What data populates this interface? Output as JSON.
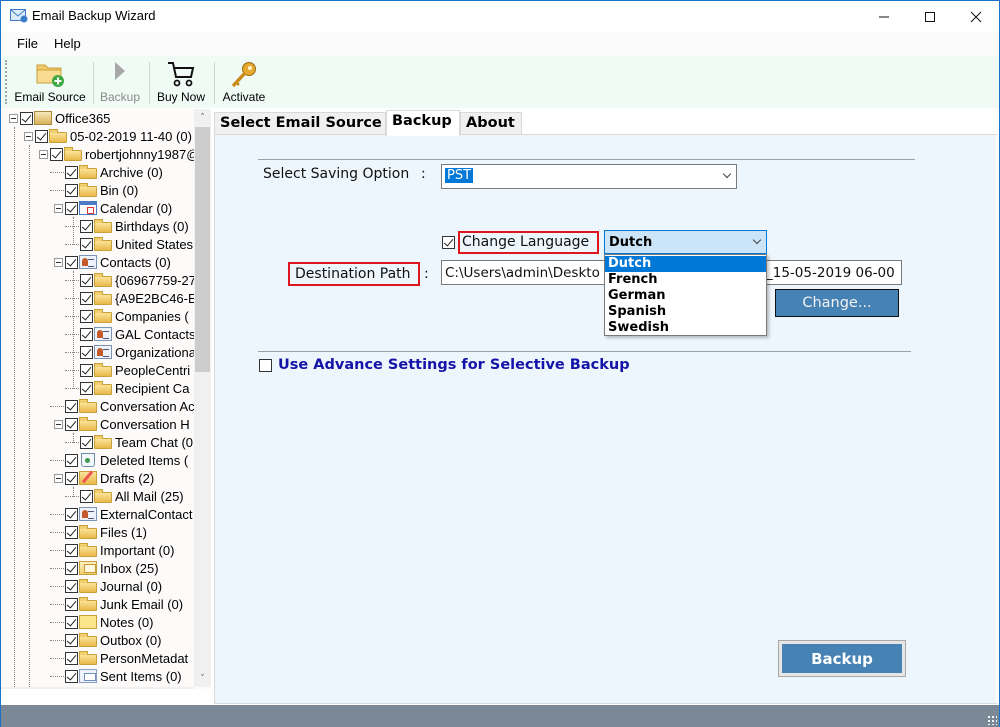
{
  "window": {
    "title": "Email Backup Wizard",
    "controls": {
      "minimize": "—",
      "maximize": "☐",
      "close": "✕"
    }
  },
  "menu": {
    "items": [
      "File",
      "Help"
    ]
  },
  "toolbar": {
    "items": [
      {
        "label": "Email Source",
        "icon": "folder-add-icon",
        "enabled": true
      },
      {
        "label": "Backup",
        "icon": "play-icon",
        "enabled": false
      },
      {
        "label": "Buy Now",
        "icon": "cart-icon",
        "enabled": true
      },
      {
        "label": "Activate",
        "icon": "key-icon",
        "enabled": true
      }
    ]
  },
  "tree": {
    "nodes": [
      {
        "label": "Office365",
        "icon": "root",
        "checked": true,
        "expander": true,
        "level": 0
      },
      {
        "label": "05-02-2019 11-40 (0)",
        "icon": "folder",
        "checked": true,
        "expander": true,
        "level": 1
      },
      {
        "label": "robertjohnny1987@",
        "icon": "folder",
        "checked": true,
        "expander": true,
        "level": 2
      },
      {
        "label": "Archive (0)",
        "icon": "folder",
        "checked": true,
        "level": 3
      },
      {
        "label": "Bin (0)",
        "icon": "folder",
        "checked": true,
        "level": 3
      },
      {
        "label": "Calendar (0)",
        "icon": "calendar",
        "checked": true,
        "expander": true,
        "level": 3
      },
      {
        "label": "Birthdays (0)",
        "icon": "folder",
        "checked": true,
        "level": 4
      },
      {
        "label": "United States",
        "icon": "folder",
        "checked": true,
        "level": 4
      },
      {
        "label": "Contacts (0)",
        "icon": "contact",
        "checked": true,
        "expander": true,
        "level": 3
      },
      {
        "label": "{06967759-27",
        "icon": "folder",
        "checked": true,
        "level": 4
      },
      {
        "label": "{A9E2BC46-E",
        "icon": "folder",
        "checked": true,
        "level": 4
      },
      {
        "label": "Companies (",
        "icon": "folder",
        "checked": true,
        "level": 4
      },
      {
        "label": "GAL Contacts",
        "icon": "contact",
        "checked": true,
        "level": 4
      },
      {
        "label": "Organizationa",
        "icon": "contact",
        "checked": true,
        "level": 4
      },
      {
        "label": "PeopleCentri",
        "icon": "folder",
        "checked": true,
        "level": 4
      },
      {
        "label": "Recipient Ca",
        "icon": "folder",
        "checked": true,
        "level": 4
      },
      {
        "label": "Conversation Ac",
        "icon": "folder",
        "checked": true,
        "level": 3
      },
      {
        "label": "Conversation H",
        "icon": "folder",
        "checked": true,
        "expander": true,
        "level": 3
      },
      {
        "label": "Team Chat (0",
        "icon": "folder",
        "checked": true,
        "level": 4
      },
      {
        "label": "Deleted Items (",
        "icon": "trash",
        "checked": true,
        "level": 3
      },
      {
        "label": "Drafts (2)",
        "icon": "drafts",
        "checked": true,
        "expander": true,
        "level": 3
      },
      {
        "label": "All Mail (25)",
        "icon": "folder",
        "checked": true,
        "level": 4
      },
      {
        "label": "ExternalContact",
        "icon": "contact",
        "checked": true,
        "level": 3
      },
      {
        "label": "Files (1)",
        "icon": "folder",
        "checked": true,
        "level": 3
      },
      {
        "label": "Important (0)",
        "icon": "folder",
        "checked": true,
        "level": 3
      },
      {
        "label": "Inbox (25)",
        "icon": "inbox",
        "checked": true,
        "level": 3
      },
      {
        "label": "Journal (0)",
        "icon": "folder",
        "checked": true,
        "level": 3
      },
      {
        "label": "Junk Email (0)",
        "icon": "folder",
        "checked": true,
        "level": 3
      },
      {
        "label": "Notes (0)",
        "icon": "notes",
        "checked": true,
        "level": 3
      },
      {
        "label": "Outbox (0)",
        "icon": "folder",
        "checked": true,
        "level": 3
      },
      {
        "label": "PersonMetadat",
        "icon": "folder",
        "checked": true,
        "level": 3
      },
      {
        "label": "Sent Items (0)",
        "icon": "sent",
        "checked": true,
        "level": 3
      }
    ]
  },
  "tabs": [
    {
      "label": "Select Email Source",
      "active": false
    },
    {
      "label": "Backup",
      "active": true
    },
    {
      "label": "About",
      "active": false
    }
  ],
  "backup": {
    "saving_option_label": "Select Saving Option",
    "colon": ":",
    "saving_option_value": "PST",
    "change_language_label": "Change Language",
    "change_language_checked": true,
    "language_selected": "Dutch",
    "language_options": [
      "Dutch",
      "French",
      "German",
      "Spanish",
      "Swedish"
    ],
    "destination_label": "Destination Path",
    "destination_value_left": "C:\\Users\\admin\\Deskto",
    "destination_value_right": "_15-05-2019 06-00",
    "change_button": "Change...",
    "advance_label": "Use Advance Settings for Selective Backup",
    "advance_checked": false,
    "backup_button": "Backup"
  },
  "colors": {
    "accent_button": "#4682b4",
    "selection": "#0078d7",
    "highlight_box": "#e0141c",
    "advance_text": "#1414a8",
    "panel_bg": "#eef6fd",
    "statusbar": "#7b8896"
  }
}
